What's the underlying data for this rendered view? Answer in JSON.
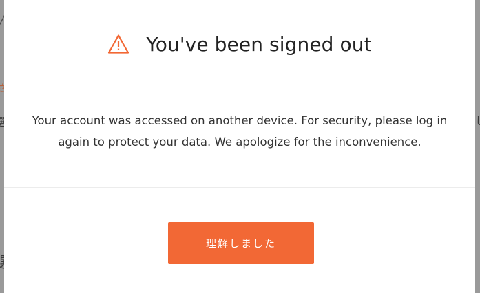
{
  "background": {
    "fragments": [
      "╱",
      "さ",
      "選",
      "し",
      "選"
    ]
  },
  "modal": {
    "icon": "warning-triangle-icon",
    "title": "You've been signed out",
    "message_line1": "Your account was accessed on another device. For security, please log in",
    "message_line2": "again to protect your data. We apologize for the inconvenience.",
    "confirm_label": "理解しました"
  },
  "colors": {
    "accent": "#f26835",
    "rule": "#d9342b",
    "icon": "#f26835"
  }
}
